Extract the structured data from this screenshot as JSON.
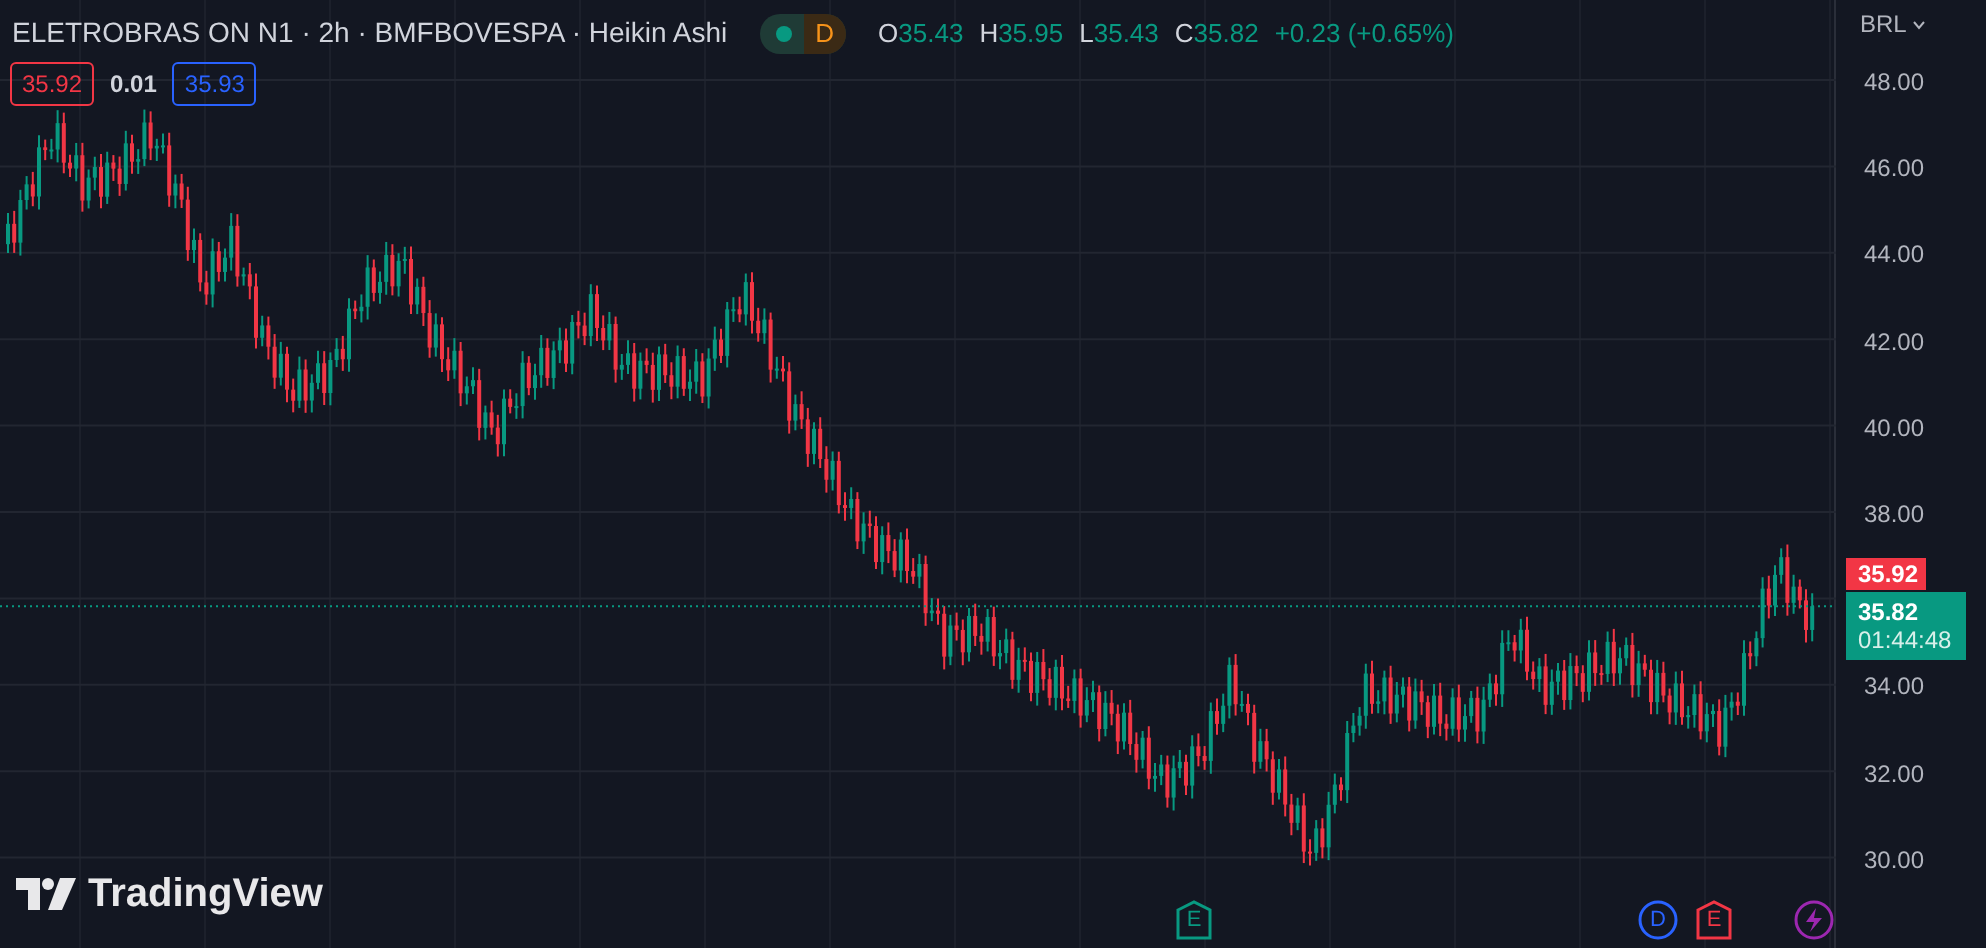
{
  "header": {
    "title": "ELETROBRAS ON N1 · 2h · BMFBOVESPA · Heikin Ashi",
    "badge": "D",
    "ohlc": [
      {
        "label": "O",
        "value": "35.43"
      },
      {
        "label": "H",
        "value": "35.95"
      },
      {
        "label": "L",
        "value": "35.43"
      },
      {
        "label": "C",
        "value": "35.82"
      }
    ],
    "change": "+0.23 (+0.65%)"
  },
  "order": {
    "sell": "35.92",
    "spread": "0.01",
    "buy": "35.93"
  },
  "price_axis": {
    "currency": "BRL",
    "ticks": [
      "48.00",
      "46.00",
      "44.00",
      "42.00",
      "40.00",
      "38.00",
      "34.00",
      "32.00",
      "30.00"
    ],
    "bid": "35.92",
    "last": "35.82",
    "countdown": "01:44:48"
  },
  "events": [
    {
      "kind": "shield",
      "label": "E",
      "color": "#089981"
    },
    {
      "kind": "circle",
      "label": "D",
      "color": "#2962ff"
    },
    {
      "kind": "shield",
      "label": "E",
      "color": "#f23645"
    },
    {
      "kind": "flash",
      "color": "#9c27b0"
    }
  ],
  "logo": "TradingView"
}
